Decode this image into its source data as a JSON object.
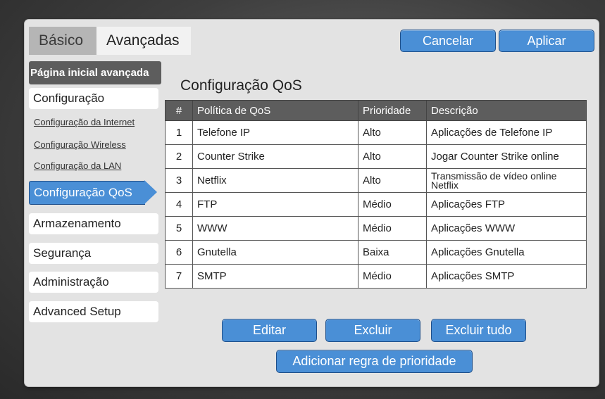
{
  "tabs": {
    "basic": "Básico",
    "advanced": "Avançadas"
  },
  "top_buttons": {
    "cancel": "Cancelar",
    "apply": "Aplicar"
  },
  "sidebar": {
    "home": "Página inicial avançada",
    "setup": "Configuração",
    "links": [
      "Configuração da Internet",
      "Configuração Wireless",
      "Configuração da LAN"
    ],
    "active": "Configuração QoS",
    "items": [
      "Armazenamento",
      "Segurança",
      "Administração",
      "Advanced Setup"
    ]
  },
  "page_title": "Configuração QoS",
  "table": {
    "headers": [
      "#",
      "Política de QoS",
      "Prioridade",
      "Descrição"
    ],
    "rows": [
      {
        "n": "1",
        "policy": "Telefone IP",
        "priority": "Alto",
        "desc": "Aplicações de Telefone IP"
      },
      {
        "n": "2",
        "policy": "Counter Strike",
        "priority": "Alto",
        "desc": "Jogar Counter Strike online"
      },
      {
        "n": "3",
        "policy": "Netflix",
        "priority": "Alto",
        "desc": "Transmissão de vídeo online Netflix"
      },
      {
        "n": "4",
        "policy": "FTP",
        "priority": "Médio",
        "desc": "Aplicações FTP"
      },
      {
        "n": "5",
        "policy": "WWW",
        "priority": "Médio",
        "desc": "Aplicações WWW"
      },
      {
        "n": "6",
        "policy": "Gnutella",
        "priority": "Baixa",
        "desc": "Aplicações Gnutella"
      },
      {
        "n": "7",
        "policy": "SMTP",
        "priority": "Médio",
        "desc": "Aplicações SMTP"
      }
    ]
  },
  "actions": {
    "edit": "Editar",
    "delete": "Excluir",
    "delete_all": "Excluir tudo",
    "add_rule": "Adicionar regra de prioridade"
  },
  "colors": {
    "accent": "#4a8fd6",
    "header": "#5d5d5d",
    "panel": "#e3e3e3"
  }
}
